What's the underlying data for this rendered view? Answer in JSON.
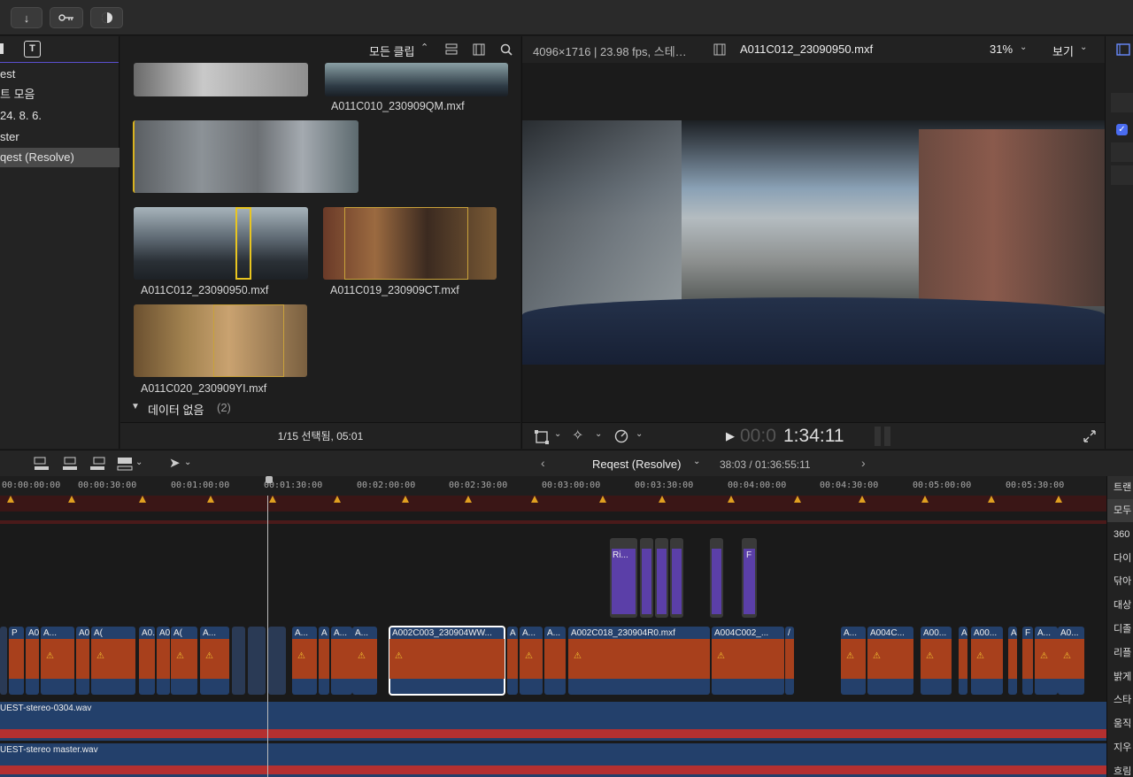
{
  "toolbar": {
    "buttons": [
      {
        "name": "import-down-arrow",
        "glyph": "↓"
      },
      {
        "name": "keyword",
        "glyph": "⚷"
      },
      {
        "name": "background-tasks",
        "glyph": "◐"
      }
    ]
  },
  "library": {
    "items": [
      "est",
      "트 모음",
      "24. 8. 6.",
      "ster",
      "qest (Resolve)"
    ],
    "selected_index": 4
  },
  "browser": {
    "filter_label": "모든 클립",
    "clips": [
      {
        "name": "A011C010_230909QM.mxf"
      },
      {
        "name": "A011C012_230909SO.mxf"
      },
      {
        "name": "A011C019_230909CT.mxf"
      },
      {
        "name": "A011C020_230909YI.mxf"
      }
    ],
    "clip_name_visible": [
      "A011C010_230909QM.mxf",
      "A011C012_23090950.mxf",
      "A011C019_230909CT.mxf",
      "A011C020_230909YI.mxf"
    ],
    "group_label": "데이터 없음",
    "group_count": "(2)",
    "footer": "1/15 선택됨, 05:01"
  },
  "viewer": {
    "format": "4096×1716 | 23.98 fps, 스테…",
    "clip_title": "A011C012_23090950.mxf",
    "zoom": "31%",
    "view_label": "보기",
    "timecode_dim": "00:0",
    "timecode": "1:34:11"
  },
  "timeline": {
    "project_name": "Reqest (Resolve)",
    "duration": "38:03 / 01:36:55:11",
    "ruler_labels": [
      "00:00:00:00",
      "00:00:30:00",
      "00:01:00:00",
      "00:01:30:00",
      "00:02:00:00",
      "00:02:30:00",
      "00:03:00:00",
      "00:03:30:00",
      "00:04:00:00",
      "00:04:30:00",
      "00:05:00:00",
      "00:05:30:00"
    ],
    "connected_clips": [
      {
        "label": "Ri..."
      },
      {
        "label": ""
      },
      {
        "label": ""
      },
      {
        "label": ""
      },
      {
        "label": ""
      },
      {
        "label": "F"
      }
    ],
    "primary_clips": [
      {
        "label": "P"
      },
      {
        "label": "A01..."
      },
      {
        "label": "A..."
      },
      {
        "label": "A0..."
      },
      {
        "label": "A("
      },
      {
        "label": "A0..."
      },
      {
        "label": "A0..."
      },
      {
        "label": "A("
      },
      {
        "label": "A..."
      },
      {
        "label": "A..."
      },
      {
        "label": "A"
      },
      {
        "label": "A..."
      },
      {
        "label": "A..."
      },
      {
        "label": "A002C003_230904WW..."
      },
      {
        "label": "A"
      },
      {
        "label": "A..."
      },
      {
        "label": "A..."
      },
      {
        "label": "A002C018_230904R0.mxf"
      },
      {
        "label": "A004C002_..."
      },
      {
        "label": "/"
      },
      {
        "label": "A..."
      },
      {
        "label": "A004C..."
      },
      {
        "label": "A00..."
      },
      {
        "label": "A("
      },
      {
        "label": "A00..."
      },
      {
        "label": "A"
      },
      {
        "label": "F"
      },
      {
        "label": "A..."
      },
      {
        "label": "A0..."
      }
    ],
    "audio_tracks": [
      "UEST-stereo-0304.wav",
      "UEST-stereo master.wav"
    ],
    "clip_missing_label": "미디어 없음"
  },
  "effects_panel": {
    "header": "트랜",
    "items": [
      "모두",
      "360",
      "다이",
      "닦아",
      "대상",
      "디졸",
      "리플",
      "밝게",
      "스타",
      "움직",
      "지우",
      "흐림"
    ]
  },
  "colors": {
    "accent": "#5a4fd0",
    "clip_blue": "#24406b",
    "clip_orange": "#a8401c",
    "connected_purple": "#5b3fa8",
    "marker_red": "#3a1616",
    "skimmer_yellow": "#e8c520"
  }
}
